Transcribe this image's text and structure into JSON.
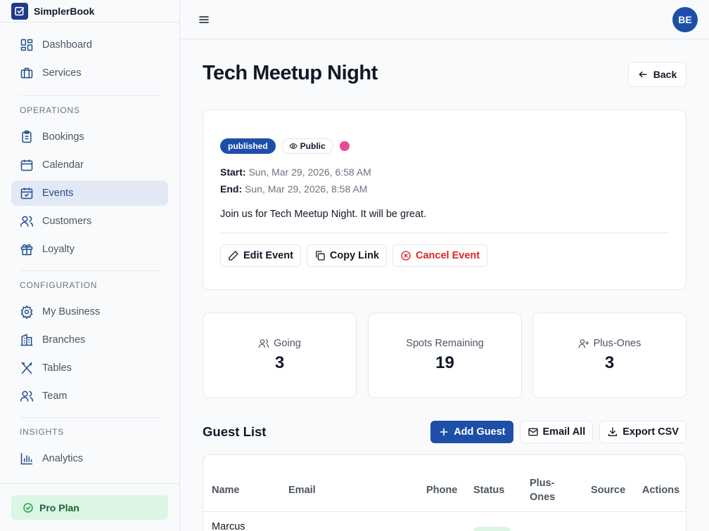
{
  "app": {
    "name": "SimplerBook"
  },
  "sidebar": {
    "top_items": [
      {
        "label": "Dashboard",
        "icon": "dashboard-icon"
      },
      {
        "label": "Services",
        "icon": "briefcase-icon"
      }
    ],
    "sections": [
      {
        "label": "OPERATIONS",
        "items": [
          {
            "label": "Bookings",
            "icon": "clipboard-icon"
          },
          {
            "label": "Calendar",
            "icon": "calendar-icon"
          },
          {
            "label": "Events",
            "icon": "calendar-check-icon",
            "active": true
          },
          {
            "label": "Customers",
            "icon": "users-icon"
          },
          {
            "label": "Loyalty",
            "icon": "gift-icon"
          }
        ]
      },
      {
        "label": "CONFIGURATION",
        "items": [
          {
            "label": "My Business",
            "icon": "gear-icon"
          },
          {
            "label": "Branches",
            "icon": "building-icon"
          },
          {
            "label": "Tables",
            "icon": "utensils-icon"
          },
          {
            "label": "Team",
            "icon": "users-icon"
          }
        ]
      },
      {
        "label": "INSIGHTS",
        "items": [
          {
            "label": "Analytics",
            "icon": "bar-chart-icon"
          }
        ]
      }
    ],
    "plan": "Pro Plan"
  },
  "topbar": {
    "avatar_initials": "BE"
  },
  "event": {
    "title": "Tech Meetup Night",
    "back_label": "Back",
    "status": "published",
    "visibility": "Public",
    "color": "#ec4899",
    "start_label": "Start:",
    "start_value": "Sun, Mar 29, 2026, 6:58 AM",
    "end_label": "End:",
    "end_value": "Sun, Mar 29, 2026, 8:58 AM",
    "description": "Join us for Tech Meetup Night. It will be great.",
    "actions": {
      "edit": "Edit Event",
      "copy": "Copy Link",
      "cancel": "Cancel Event"
    }
  },
  "stats": [
    {
      "label": "Going",
      "value": "3",
      "icon": "users-icon"
    },
    {
      "label": "Spots Remaining",
      "value": "19",
      "icon": ""
    },
    {
      "label": "Plus-Ones",
      "value": "3",
      "icon": "user-plus-icon"
    }
  ],
  "guests": {
    "title": "Guest List",
    "add_label": "Add Guest",
    "email_label": "Email All",
    "export_label": "Export CSV",
    "columns": [
      "Name",
      "Email",
      "Phone",
      "Status",
      "Plus-\nOnes",
      "Source",
      "Actions"
    ],
    "rows": [
      {
        "name": "Marcus"
      }
    ]
  },
  "colors": {
    "accent": "#1d4fa8",
    "active_bg": "#e3e9f4",
    "success_bg": "#dcf5e4",
    "danger": "#dc2626"
  }
}
